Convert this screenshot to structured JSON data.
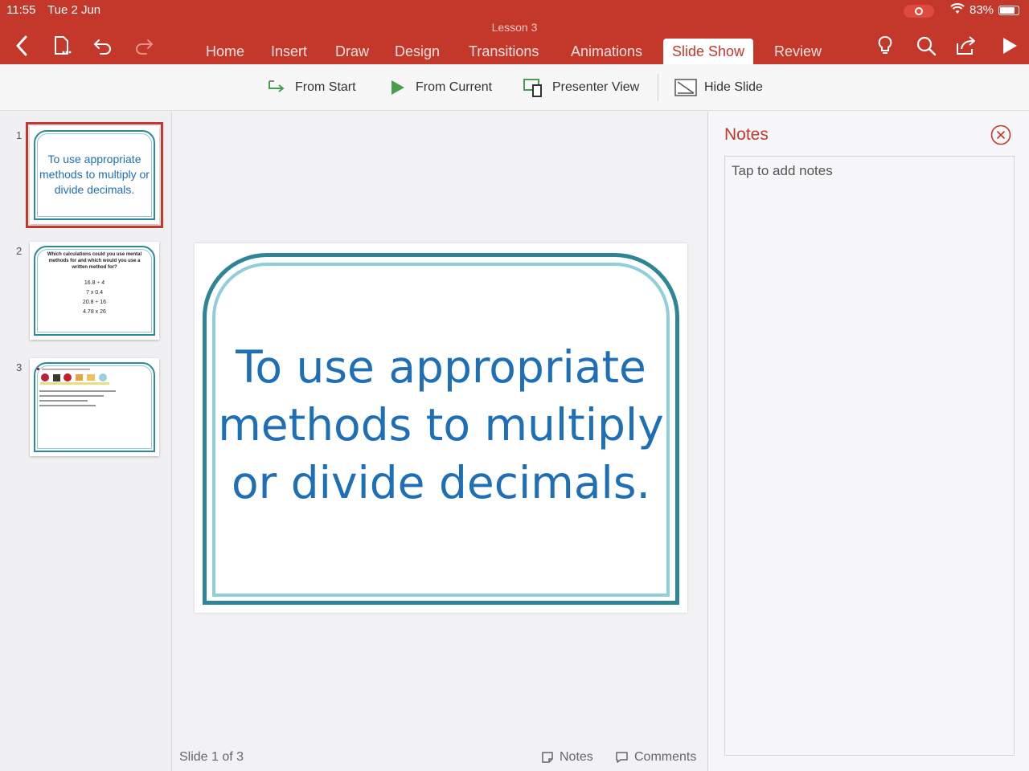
{
  "status": {
    "time": "11:55",
    "date": "Tue 2 Jun",
    "battery": "83%",
    "battery_level": 0.83
  },
  "document": {
    "title": "Lesson 3"
  },
  "toolbar": {
    "tabs": [
      {
        "label": "Home"
      },
      {
        "label": "Insert"
      },
      {
        "label": "Draw"
      },
      {
        "label": "Design"
      },
      {
        "label": "Transitions"
      },
      {
        "label": "Animations"
      },
      {
        "label": "Slide Show",
        "active": true
      },
      {
        "label": "Review"
      }
    ],
    "icons": [
      "back-icon",
      "file-icon",
      "undo-icon",
      "redo-icon",
      "lightbulb-icon",
      "search-icon",
      "share-icon",
      "play-icon"
    ]
  },
  "ribbon": {
    "from_start": "From Start",
    "from_current": "From Current",
    "presenter_view": "Presenter View",
    "hide_slide": "Hide Slide"
  },
  "thumbnails": [
    {
      "number": "1",
      "text": "To use appropriate methods to multiply or divide decimals."
    },
    {
      "number": "2",
      "title": "Which calculations could you use mental methods for and which would you use a written method for?",
      "calcs": [
        "16.8 ÷ 4",
        "7 x 0.4",
        "20.8 ÷ 16",
        "4.78 x 26"
      ]
    },
    {
      "number": "3"
    }
  ],
  "slide": {
    "text": "To use appropriate methods to multiply or divide decimals."
  },
  "footer": {
    "slide_count": "Slide 1 of 3",
    "notes": "Notes",
    "comments": "Comments"
  },
  "notes": {
    "title": "Notes",
    "placeholder": "Tap to add notes"
  },
  "colors": {
    "accent": "#c3382a",
    "slide_text": "#1f6fb6",
    "frame_dark": "#2d8595",
    "frame_light": "#8fcfd9"
  }
}
